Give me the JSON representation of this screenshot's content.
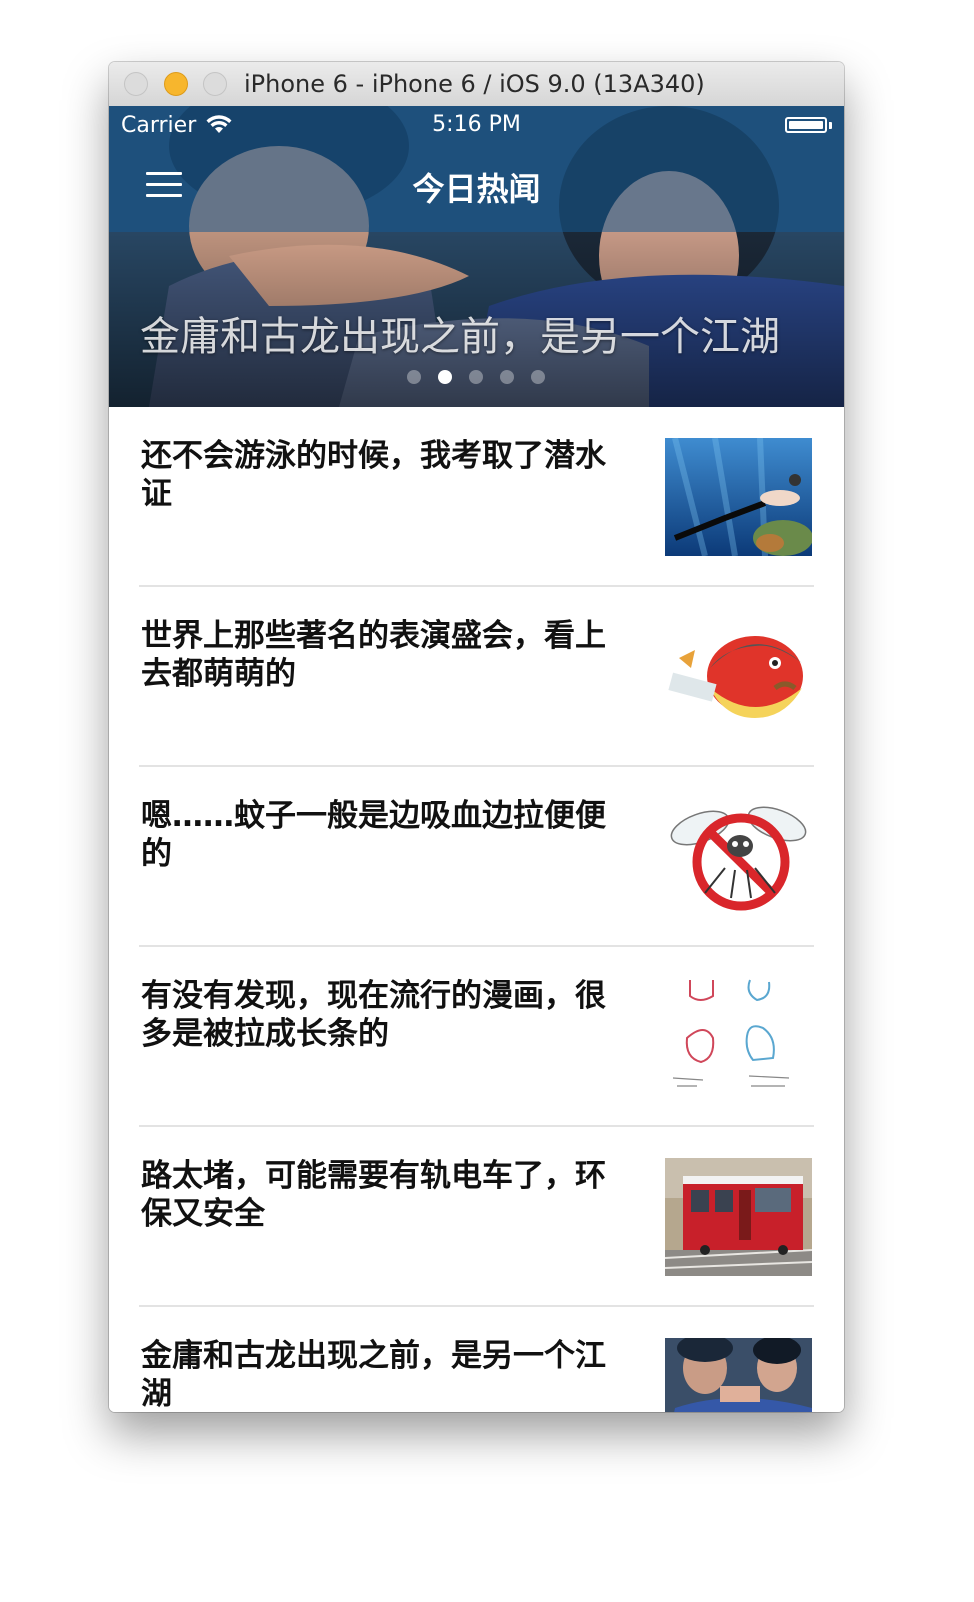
{
  "window": {
    "title": "iPhone 6 - iPhone 6 / iOS 9.0 (13A340)"
  },
  "status_bar": {
    "carrier": "Carrier",
    "time": "5:16 PM",
    "icons": [
      "wifi-icon",
      "battery-icon"
    ]
  },
  "nav": {
    "title": "今日热闻",
    "menu_icon": "hamburger-menu-icon"
  },
  "hero": {
    "caption": "金庸和古龙出现之前，是另一个江湖",
    "page_count": 5,
    "active_page": 2
  },
  "news": [
    {
      "title": "还不会游泳的时候，我考取了潜水证",
      "thumb": "diver-underwater-image"
    },
    {
      "title": "世界上那些著名的表演盛会，看上去都萌萌的",
      "thumb": "cartoon-bird-illustration"
    },
    {
      "title": "嗯……蚊子一般是边吸血边拉便便的",
      "thumb": "no-mosquito-sign-image"
    },
    {
      "title": "有没有发现，现在流行的漫画，很多是被拉成长条的",
      "thumb": "comic-sketch-image"
    },
    {
      "title": "路太堵，可能需要有轨电车了，环保又安全",
      "thumb": "red-tram-image"
    },
    {
      "title": "金庸和古龙出现之前，是另一个江湖",
      "thumb": "martial-arts-still-image"
    }
  ]
}
